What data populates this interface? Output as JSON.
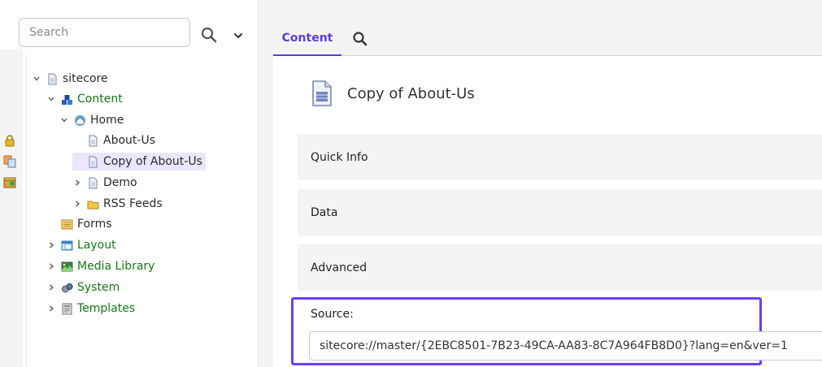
{
  "left_panel": {
    "search": {
      "placeholder": "Search"
    },
    "tree": [
      {
        "label": "sitecore",
        "expanded": true,
        "icon": "document-icon"
      },
      {
        "label": "Content",
        "expanded": true,
        "icon": "content-cubes-icon"
      },
      {
        "label": "Home",
        "expanded": true,
        "icon": "home-icon"
      },
      {
        "label": "About-Us",
        "icon": "document-icon"
      },
      {
        "label": "Copy of About-Us",
        "icon": "document-icon",
        "selected": true
      },
      {
        "label": "Demo",
        "expanded": false,
        "icon": "document-icon"
      },
      {
        "label": "RSS Feeds",
        "expanded": false,
        "icon": "folder-icon"
      },
      {
        "label": "Forms",
        "icon": "forms-icon"
      },
      {
        "label": "Layout",
        "expanded": false,
        "icon": "layout-icon"
      },
      {
        "label": "Media Library",
        "expanded": false,
        "icon": "media-library-icon"
      },
      {
        "label": "System",
        "expanded": false,
        "icon": "system-icon"
      },
      {
        "label": "Templates",
        "expanded": false,
        "icon": "templates-icon"
      }
    ],
    "gutter_icons": [
      "lock-icon",
      "duplicate-icon",
      "package-icon"
    ]
  },
  "tabs": [
    {
      "label": "Content",
      "active": true
    },
    {
      "icon": "search-icon"
    }
  ],
  "item": {
    "title": "Copy of About-Us",
    "icon": "document-icon"
  },
  "sections": {
    "quick_info": "Quick Info",
    "data": "Data",
    "advanced": "Advanced"
  },
  "source": {
    "label": "Source:",
    "value": "sitecore://master/{2EBC8501-7B23-49CA-AA83-8C7A964FB8D0}?lang=en&ver=1"
  },
  "colors": {
    "accent": "#5f3ce0",
    "highlight_border": "#6b3ffa",
    "tree_green": "#137a13",
    "selected_bg": "#ebe6fb"
  }
}
